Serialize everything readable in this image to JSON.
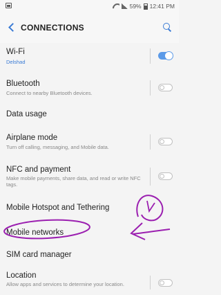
{
  "status_bar": {
    "signal_text": "59%",
    "time": "12:41 PM"
  },
  "header": {
    "title": "CONNECTIONS"
  },
  "items": [
    {
      "title": "Wi-Fi",
      "subtitle": "Delshad",
      "toggle": "on"
    },
    {
      "title": "Bluetooth",
      "subtitle": "Connect to nearby Bluetooth devices.",
      "toggle": "off"
    },
    {
      "title": "Data usage"
    },
    {
      "title": "Airplane mode",
      "subtitle": "Turn off calling, messaging, and Mobile data.",
      "toggle": "off"
    },
    {
      "title": "NFC and payment",
      "subtitle": "Make mobile payments, share data, and read or write NFC tags.",
      "toggle": "off"
    },
    {
      "title": "Mobile Hotspot and Tethering"
    },
    {
      "title": "Mobile networks"
    },
    {
      "title": "SIM card manager"
    },
    {
      "title": "Location",
      "subtitle": "Allow apps and services to determine your location.",
      "toggle": "off"
    }
  ],
  "colors": {
    "accent": "#3a7bd5",
    "toggle_on": "#5b9ae8",
    "annotation": "#9b1fb0"
  }
}
